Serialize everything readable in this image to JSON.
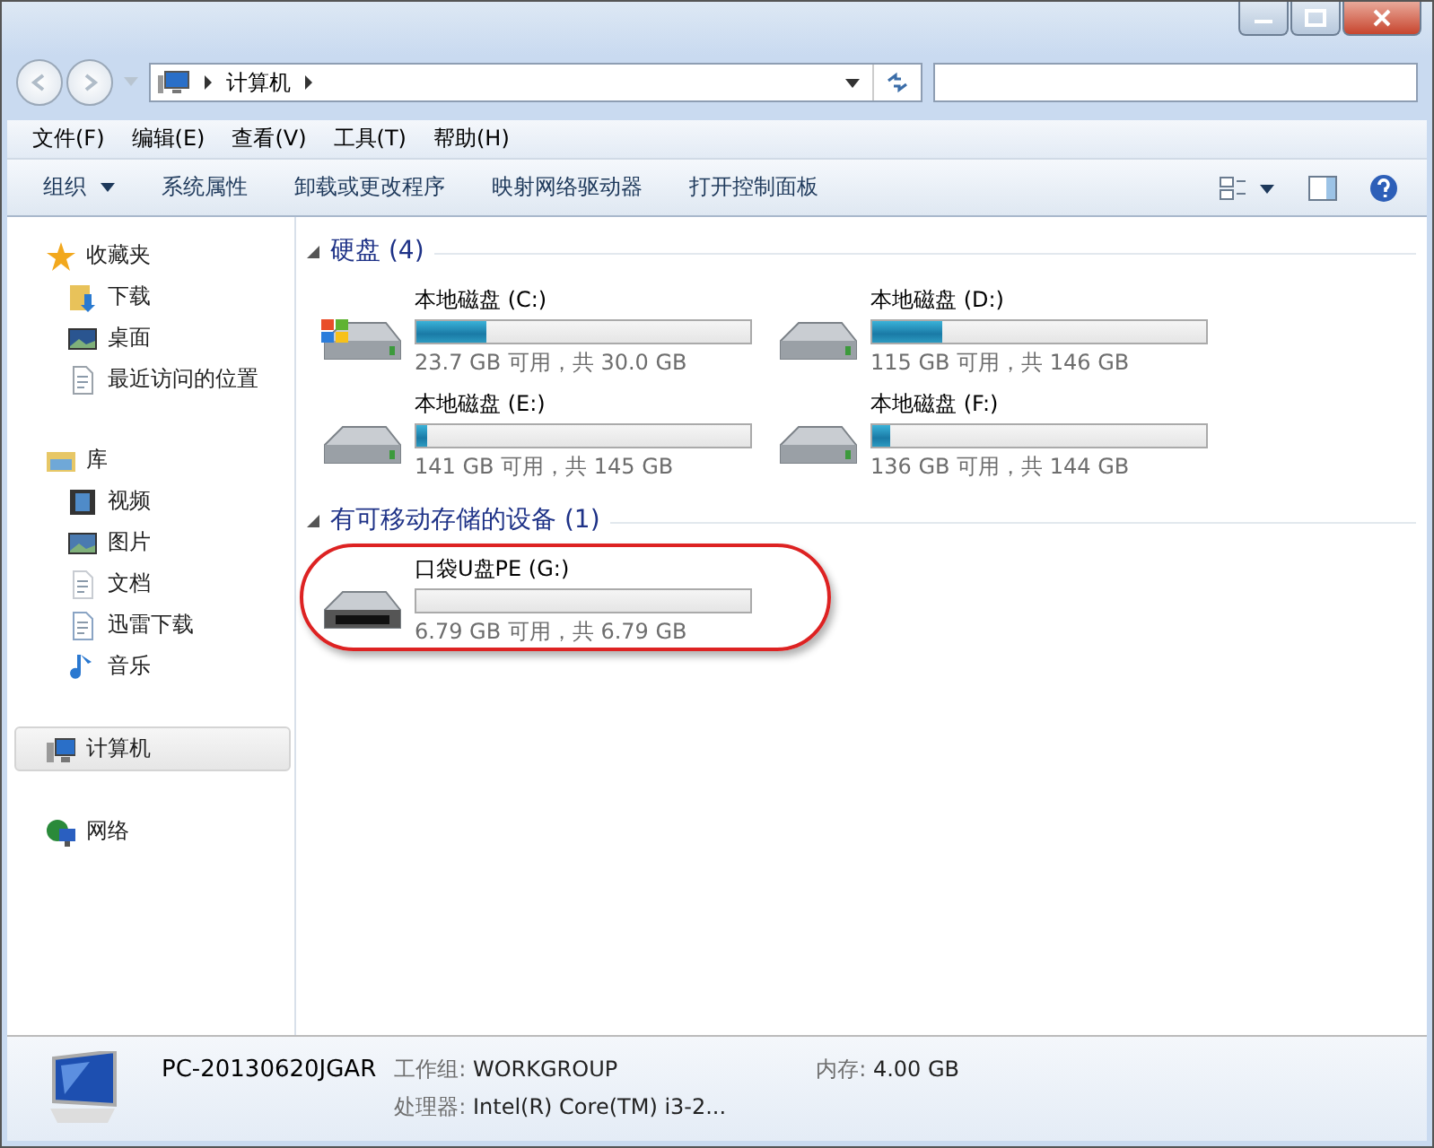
{
  "address": {
    "crumbs": [
      "计算机"
    ]
  },
  "menu": [
    "文件(F)",
    "编辑(E)",
    "查看(V)",
    "工具(T)",
    "帮助(H)"
  ],
  "toolbar": [
    {
      "label": "组织",
      "dropdown": true
    },
    {
      "label": "系统属性",
      "dropdown": false
    },
    {
      "label": "卸载或更改程序",
      "dropdown": false
    },
    {
      "label": "映射网络驱动器",
      "dropdown": false
    },
    {
      "label": "打开控制面板",
      "dropdown": false
    }
  ],
  "sidebar": {
    "groups": [
      {
        "label": "收藏夹",
        "kind": "star",
        "selected": false,
        "children": [
          {
            "label": "下载",
            "kind": "download"
          },
          {
            "label": "桌面",
            "kind": "desktop"
          },
          {
            "label": "最近访问的位置",
            "kind": "recent"
          }
        ]
      },
      {
        "label": "库",
        "kind": "library",
        "selected": false,
        "children": [
          {
            "label": "视频",
            "kind": "video"
          },
          {
            "label": "图片",
            "kind": "image"
          },
          {
            "label": "文档",
            "kind": "doc"
          },
          {
            "label": "迅雷下载",
            "kind": "doc2"
          },
          {
            "label": "音乐",
            "kind": "music"
          }
        ]
      },
      {
        "label": "计算机",
        "kind": "computer",
        "selected": true
      },
      {
        "label": "网络",
        "kind": "network",
        "selected": false
      }
    ]
  },
  "sections": [
    {
      "title": "硬盘 (4)",
      "expanded": true,
      "drives": [
        {
          "name": "本地磁盘 (C:)",
          "kind": "system",
          "level": 0.21,
          "info": "23.7 GB 可用，共 30.0 GB",
          "highlighted": false
        },
        {
          "name": "本地磁盘 (D:)",
          "kind": "disk",
          "level": 0.21,
          "info": "115 GB 可用，共 146 GB",
          "highlighted": false
        },
        {
          "name": "本地磁盘 (E:)",
          "kind": "disk",
          "level": 0.03,
          "info": "141 GB 可用，共 145 GB",
          "highlighted": false
        },
        {
          "name": "本地磁盘 (F:)",
          "kind": "disk",
          "level": 0.055,
          "info": "136 GB 可用，共 144 GB",
          "highlighted": false
        }
      ]
    },
    {
      "title": "有可移动存储的设备 (1)",
      "expanded": true,
      "drives": [
        {
          "name": "口袋U盘PE (G:)",
          "kind": "usb",
          "level": 0,
          "info": "6.79 GB 可用，共 6.79 GB",
          "highlighted": true
        }
      ]
    }
  ],
  "details": {
    "name": "PC-20130620JGAR",
    "fields": [
      {
        "label": "工作组:",
        "value": "WORKGROUP"
      },
      {
        "label": "内存:",
        "value": "4.00 GB"
      },
      {
        "label": "处理器:",
        "value": "Intel(R) Core(TM) i3-2..."
      }
    ]
  }
}
